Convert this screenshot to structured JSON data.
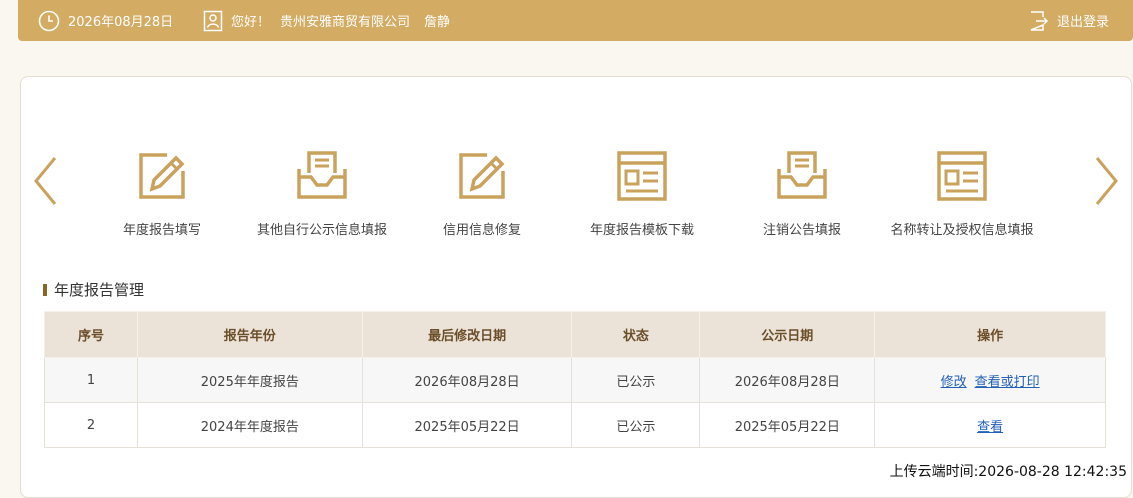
{
  "header": {
    "date": "2026年08月28日",
    "greeting": "您好！",
    "company": "贵州安雅商贸有限公司",
    "person": "詹静",
    "logout_label": "退出登录",
    "bg_color": "#d3ab62"
  },
  "nav": {
    "prev_icon": "chevron-left-icon",
    "next_icon": "chevron-right-icon",
    "shortcuts": [
      {
        "label": "年度报告填写",
        "icon": "pencil-form-icon"
      },
      {
        "label": "其他自行公示信息填报",
        "icon": "document-tray-icon"
      },
      {
        "label": "信用信息修复",
        "icon": "pencil-form-icon"
      },
      {
        "label": "年度报告模板下载",
        "icon": "template-window-icon"
      },
      {
        "label": "注销公告填报",
        "icon": "document-tray-icon"
      },
      {
        "label": "名称转让及授权信息填报",
        "icon": "template-window-icon"
      }
    ]
  },
  "section": {
    "title": "年度报告管理"
  },
  "table": {
    "headers": [
      "序号",
      "报告年份",
      "最后修改日期",
      "状态",
      "公示日期",
      "操作"
    ],
    "rows": [
      {
        "index": "1",
        "year": "2025年年度报告",
        "modified": "2026年08月28日",
        "status": "已公示",
        "published": "2026年08月28日",
        "actions": [
          "修改",
          "查看或打印"
        ]
      },
      {
        "index": "2",
        "year": "2024年年度报告",
        "modified": "2025年05月22日",
        "status": "已公示",
        "published": "2025年05月22日",
        "actions": [
          "查看"
        ]
      }
    ]
  },
  "footer": {
    "upload_time": "上传云端时间:2026-08-28 12:42:35"
  },
  "colors": {
    "accent": "#d3ab62",
    "link": "#2360b8",
    "table_header": "#ece3d8"
  }
}
